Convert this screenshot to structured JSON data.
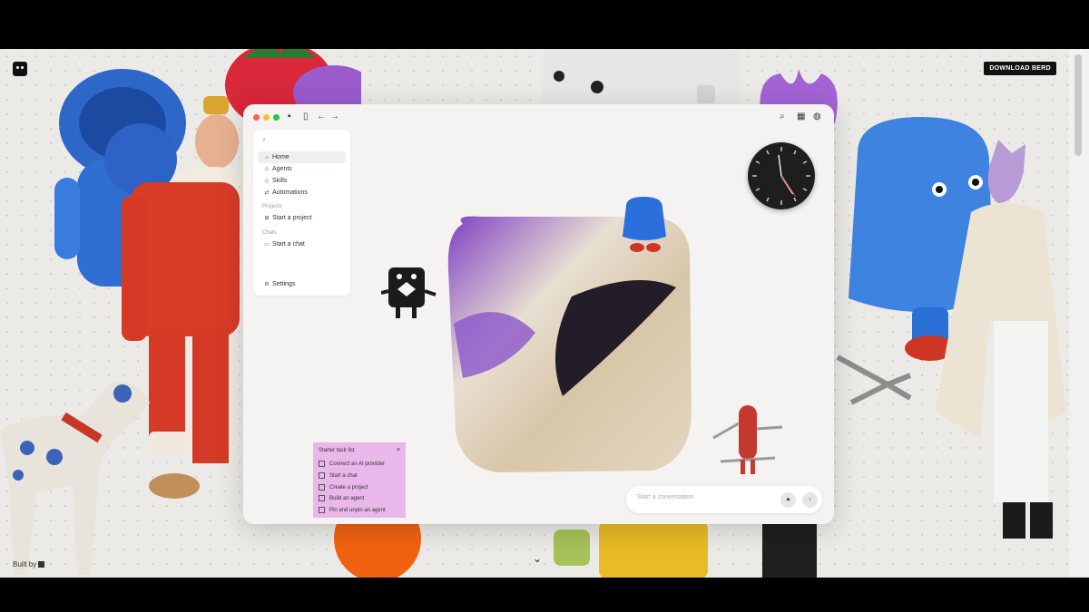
{
  "header": {
    "download_label": "DOWNLOAD BERD"
  },
  "footer": {
    "built_by": "Built by"
  },
  "window": {
    "traffic_light_colors": [
      "#ff5f57",
      "#febc2e",
      "#28c840"
    ],
    "icons": [
      "logo-icon",
      "sidebar-toggle-icon",
      "back-arrow-icon",
      "forward-arrow-icon",
      "search-icon",
      "grid-icon",
      "globe-icon"
    ]
  },
  "sidebar": {
    "items": [
      {
        "label": "Home",
        "icon": "home-icon"
      },
      {
        "label": "Agents",
        "icon": "agents-icon"
      },
      {
        "label": "Skills",
        "icon": "skills-icon"
      },
      {
        "label": "Automations",
        "icon": "automations-icon"
      }
    ],
    "projects": {
      "heading": "Projects",
      "item": "Start a project"
    },
    "chats": {
      "heading": "Chats",
      "item": "Start a chat"
    },
    "settings_label": "Settings"
  },
  "starter_tasks": {
    "title": "Starter task list",
    "close": "×",
    "items": [
      "Connect an AI provider",
      "Start a chat",
      "Create a project",
      "Build an agent",
      "Pin and unpin an agent"
    ]
  },
  "chat": {
    "placeholder": "Start a conversation"
  },
  "colors": {
    "sticky_note": "#e9b7ea",
    "download_button": "#111111"
  }
}
